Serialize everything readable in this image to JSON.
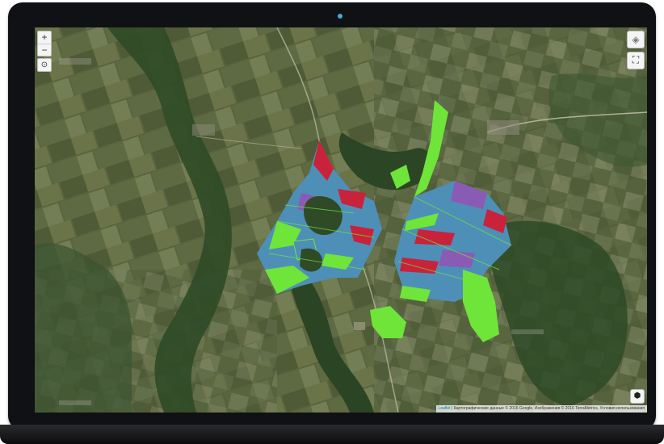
{
  "map": {
    "zoom_in_label": "+",
    "zoom_out_label": "−",
    "locate_label": "⊙",
    "layers_label": "◈",
    "fullscreen_label": "⛶",
    "info_label": "⬢",
    "attribution": {
      "leaflet_link": "Leaflet",
      "text": "| Картографические данные © 2016 Google, Изображения © 2016 TerraMetrics, Условия использования"
    }
  },
  "colors": {
    "satellite_base": "#4a5634",
    "forest": "#2f4a27",
    "field_bright_green": "#6fe53a",
    "field_blue": "#4e8fb8",
    "field_red": "#c8233a",
    "field_purple": "#8a5bb5"
  }
}
